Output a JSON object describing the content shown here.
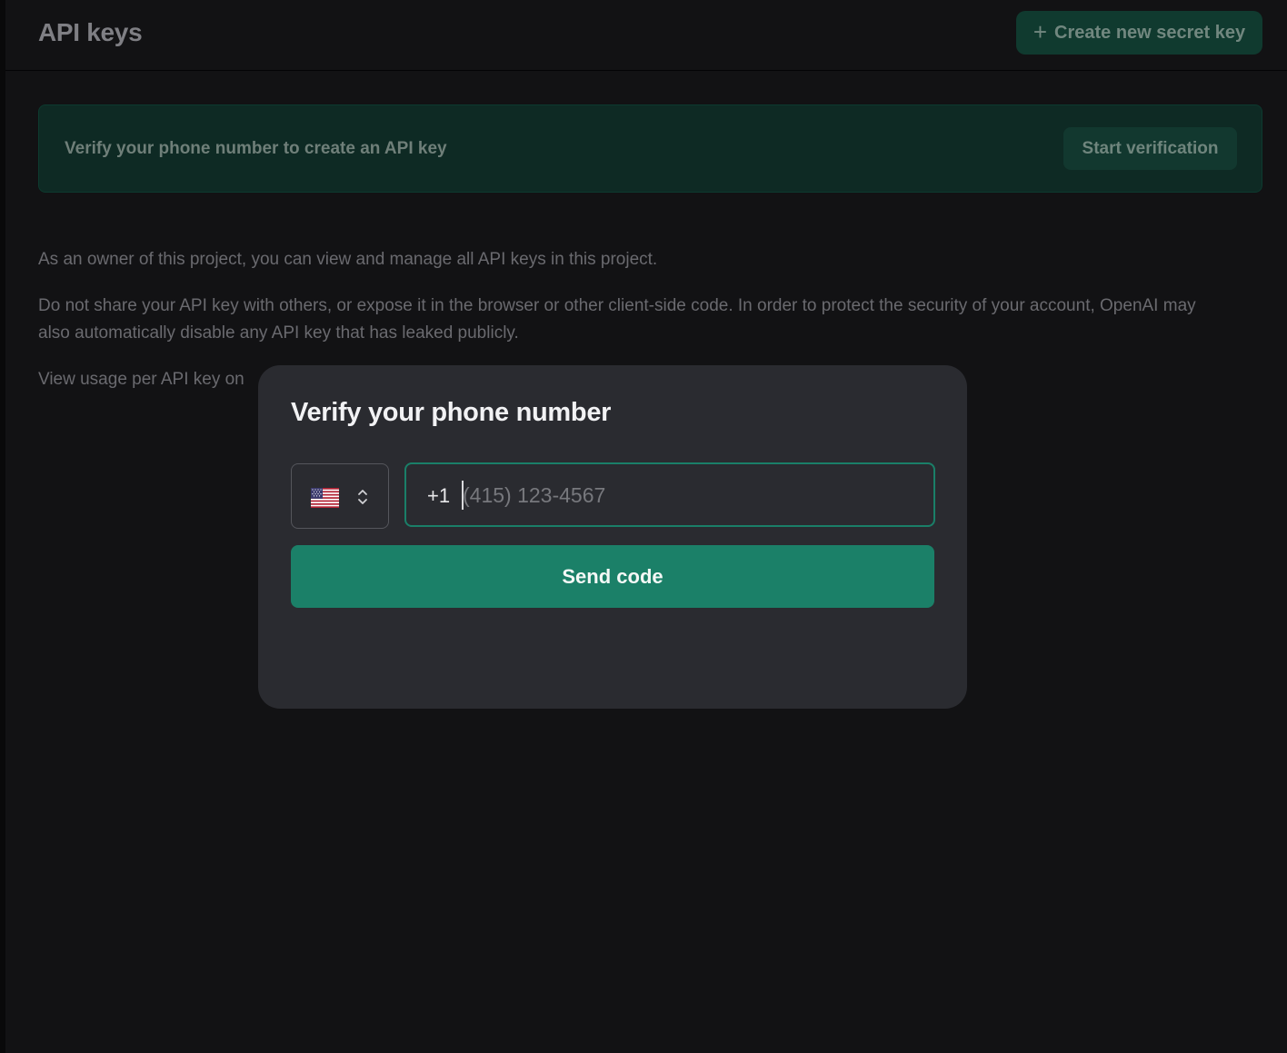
{
  "header": {
    "title": "API keys",
    "create_button": {
      "icon": "plus-icon",
      "icon_glyph": "+",
      "label": "Create new secret key"
    }
  },
  "banner": {
    "text": "Verify your phone number to create an API key",
    "button_label": "Start verification"
  },
  "description": {
    "owner_note": "As an owner of this project, you can view and manage all API keys in this project.",
    "security_note": "Do not share your API key with others, or expose it in the browser or other client-side code. In order to protect the security of your account, OpenAI may also automatically disable any API key that has leaked publicly.",
    "usage_note": "View usage per API key on"
  },
  "modal": {
    "title": "Verify your phone number",
    "country_select": {
      "flag_icon": "us-flag-icon",
      "chevron_icon": "chevron-up-down-icon"
    },
    "phone_input": {
      "dial_code": "+1",
      "value": "",
      "placeholder": "(415) 123-4567"
    },
    "send_button_label": "Send code"
  },
  "colors": {
    "background": "#121214",
    "accent": "#1b8068",
    "accent_border": "#1a7f68",
    "modal_background": "#2a2b30"
  }
}
